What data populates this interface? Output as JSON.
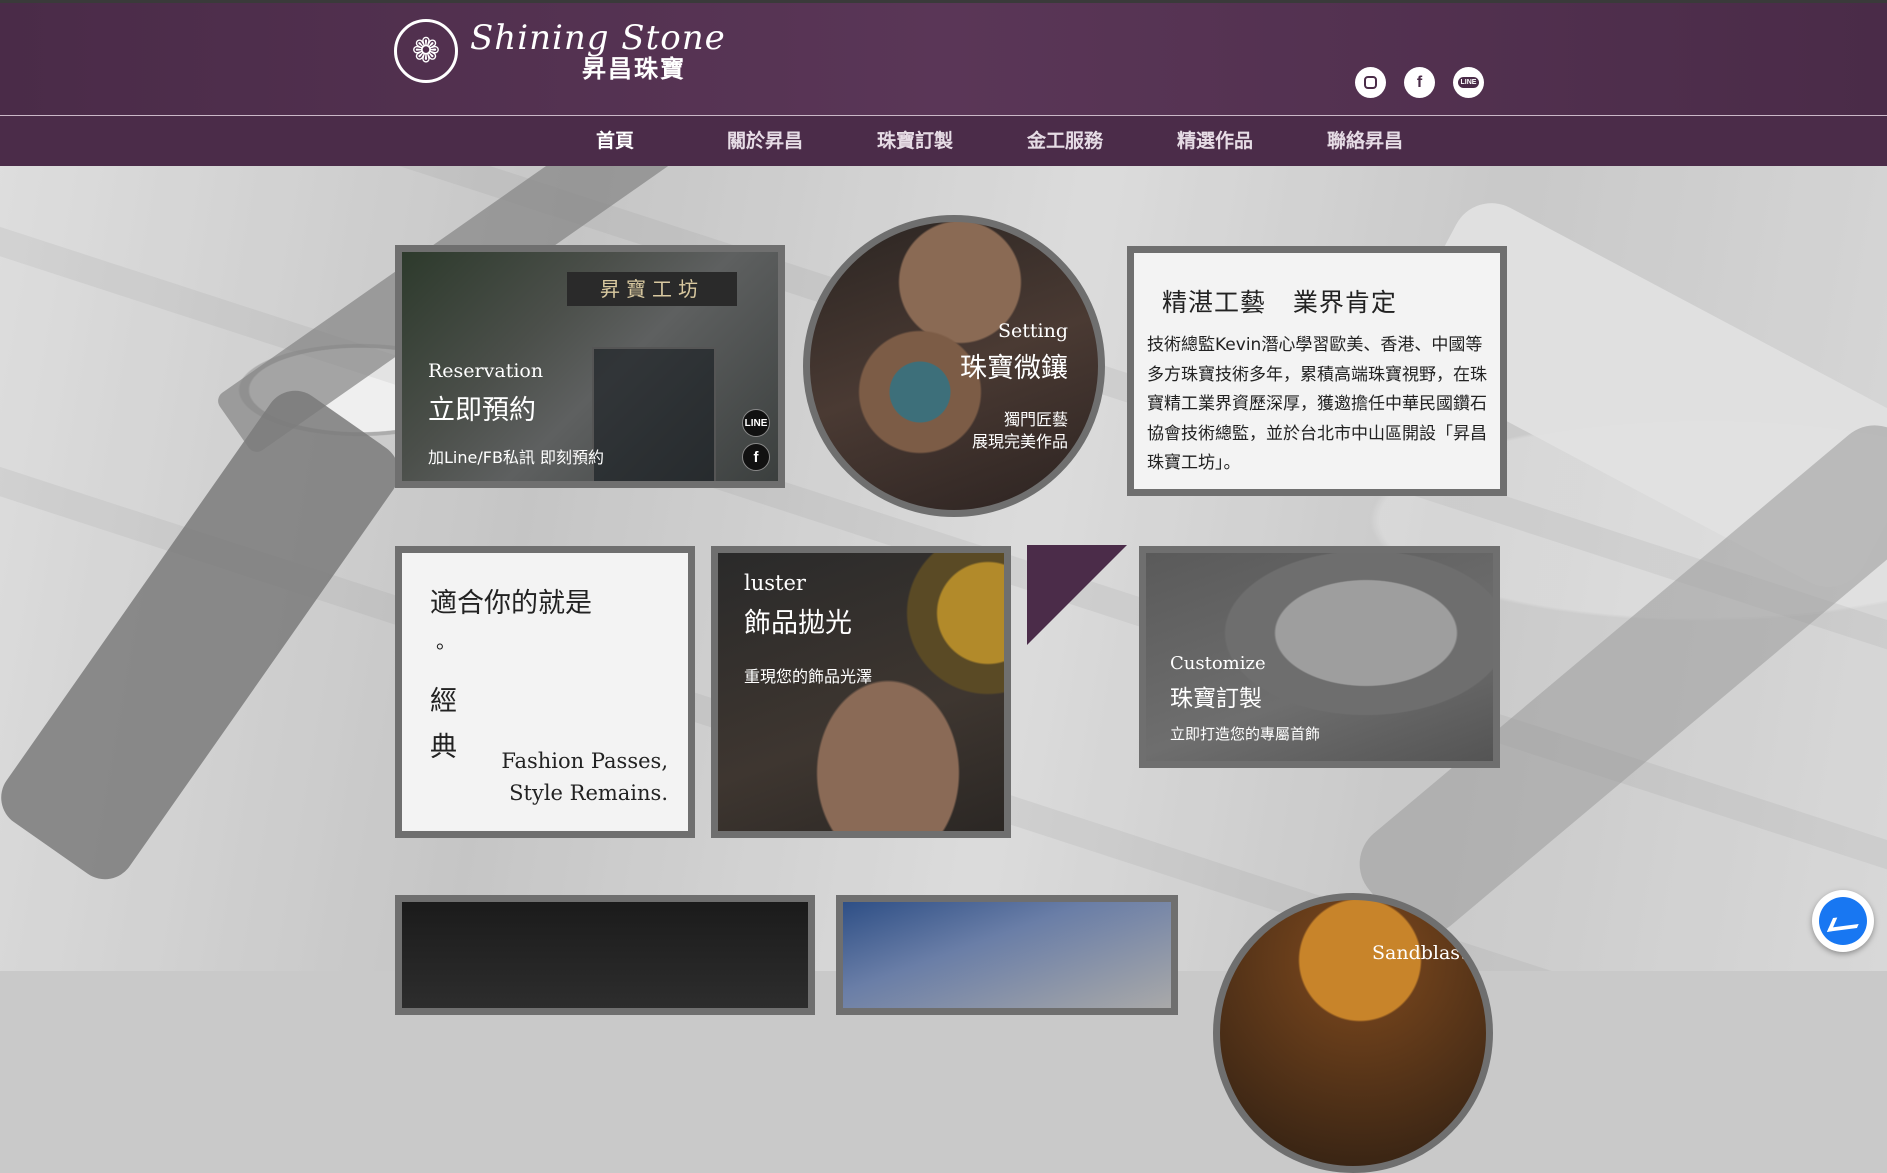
{
  "brand": {
    "logo_mark": "❁",
    "name_en": "Shining Stone",
    "name_zh": "昇昌珠寶"
  },
  "social": [
    {
      "name": "instagram-icon",
      "label": ""
    },
    {
      "name": "facebook-icon",
      "label": "f"
    },
    {
      "name": "line-icon",
      "label": "LINE"
    }
  ],
  "nav": {
    "items": [
      "首頁",
      "關於昇昌",
      "珠寶訂製",
      "金工服務",
      "精選作品",
      "聯絡昇昌"
    ]
  },
  "reservation": {
    "signboard": "昇寶工坊",
    "title_en": "Reservation",
    "title_zh": "立即預約",
    "subtitle": "加Line/FB私訊 即刻預約",
    "line_icon": "LINE",
    "fb_icon": "f"
  },
  "setting": {
    "title_en": "Setting",
    "title_zh": "珠寶微鑲",
    "desc_1": "獨門匠藝",
    "desc_2": "展現完美作品"
  },
  "about": {
    "heading": "精湛工藝   業界肯定",
    "body": "技術總監Kevin潛心學習歐美、香港、中國等多方珠寶技術多年，累積高端珠寶視野，在珠寶精工業界資歷深厚，獲邀擔任中華民國鑽石協會技術總監，並於台北市中山區開設「昇昌珠寶工坊」。"
  },
  "quote": {
    "line1": "適合你的就是",
    "line2": "。",
    "line3": "經",
    "line4": "典",
    "en1": "Fashion Passes,",
    "en2": "Style Remains."
  },
  "luster": {
    "title_en": "luster",
    "title_zh": "飾品拋光",
    "subtitle": "重現您的飾品光澤"
  },
  "customize": {
    "title_en": "Customize",
    "title_zh": "珠寶訂製",
    "subtitle": "立即打造您的專屬首飾"
  },
  "sandblast": {
    "title_en": "Sandblast"
  },
  "colors": {
    "brand_purple": "#4b2c49",
    "frame_gray": "#6f6f6f",
    "messenger_blue": "#1877f2"
  }
}
